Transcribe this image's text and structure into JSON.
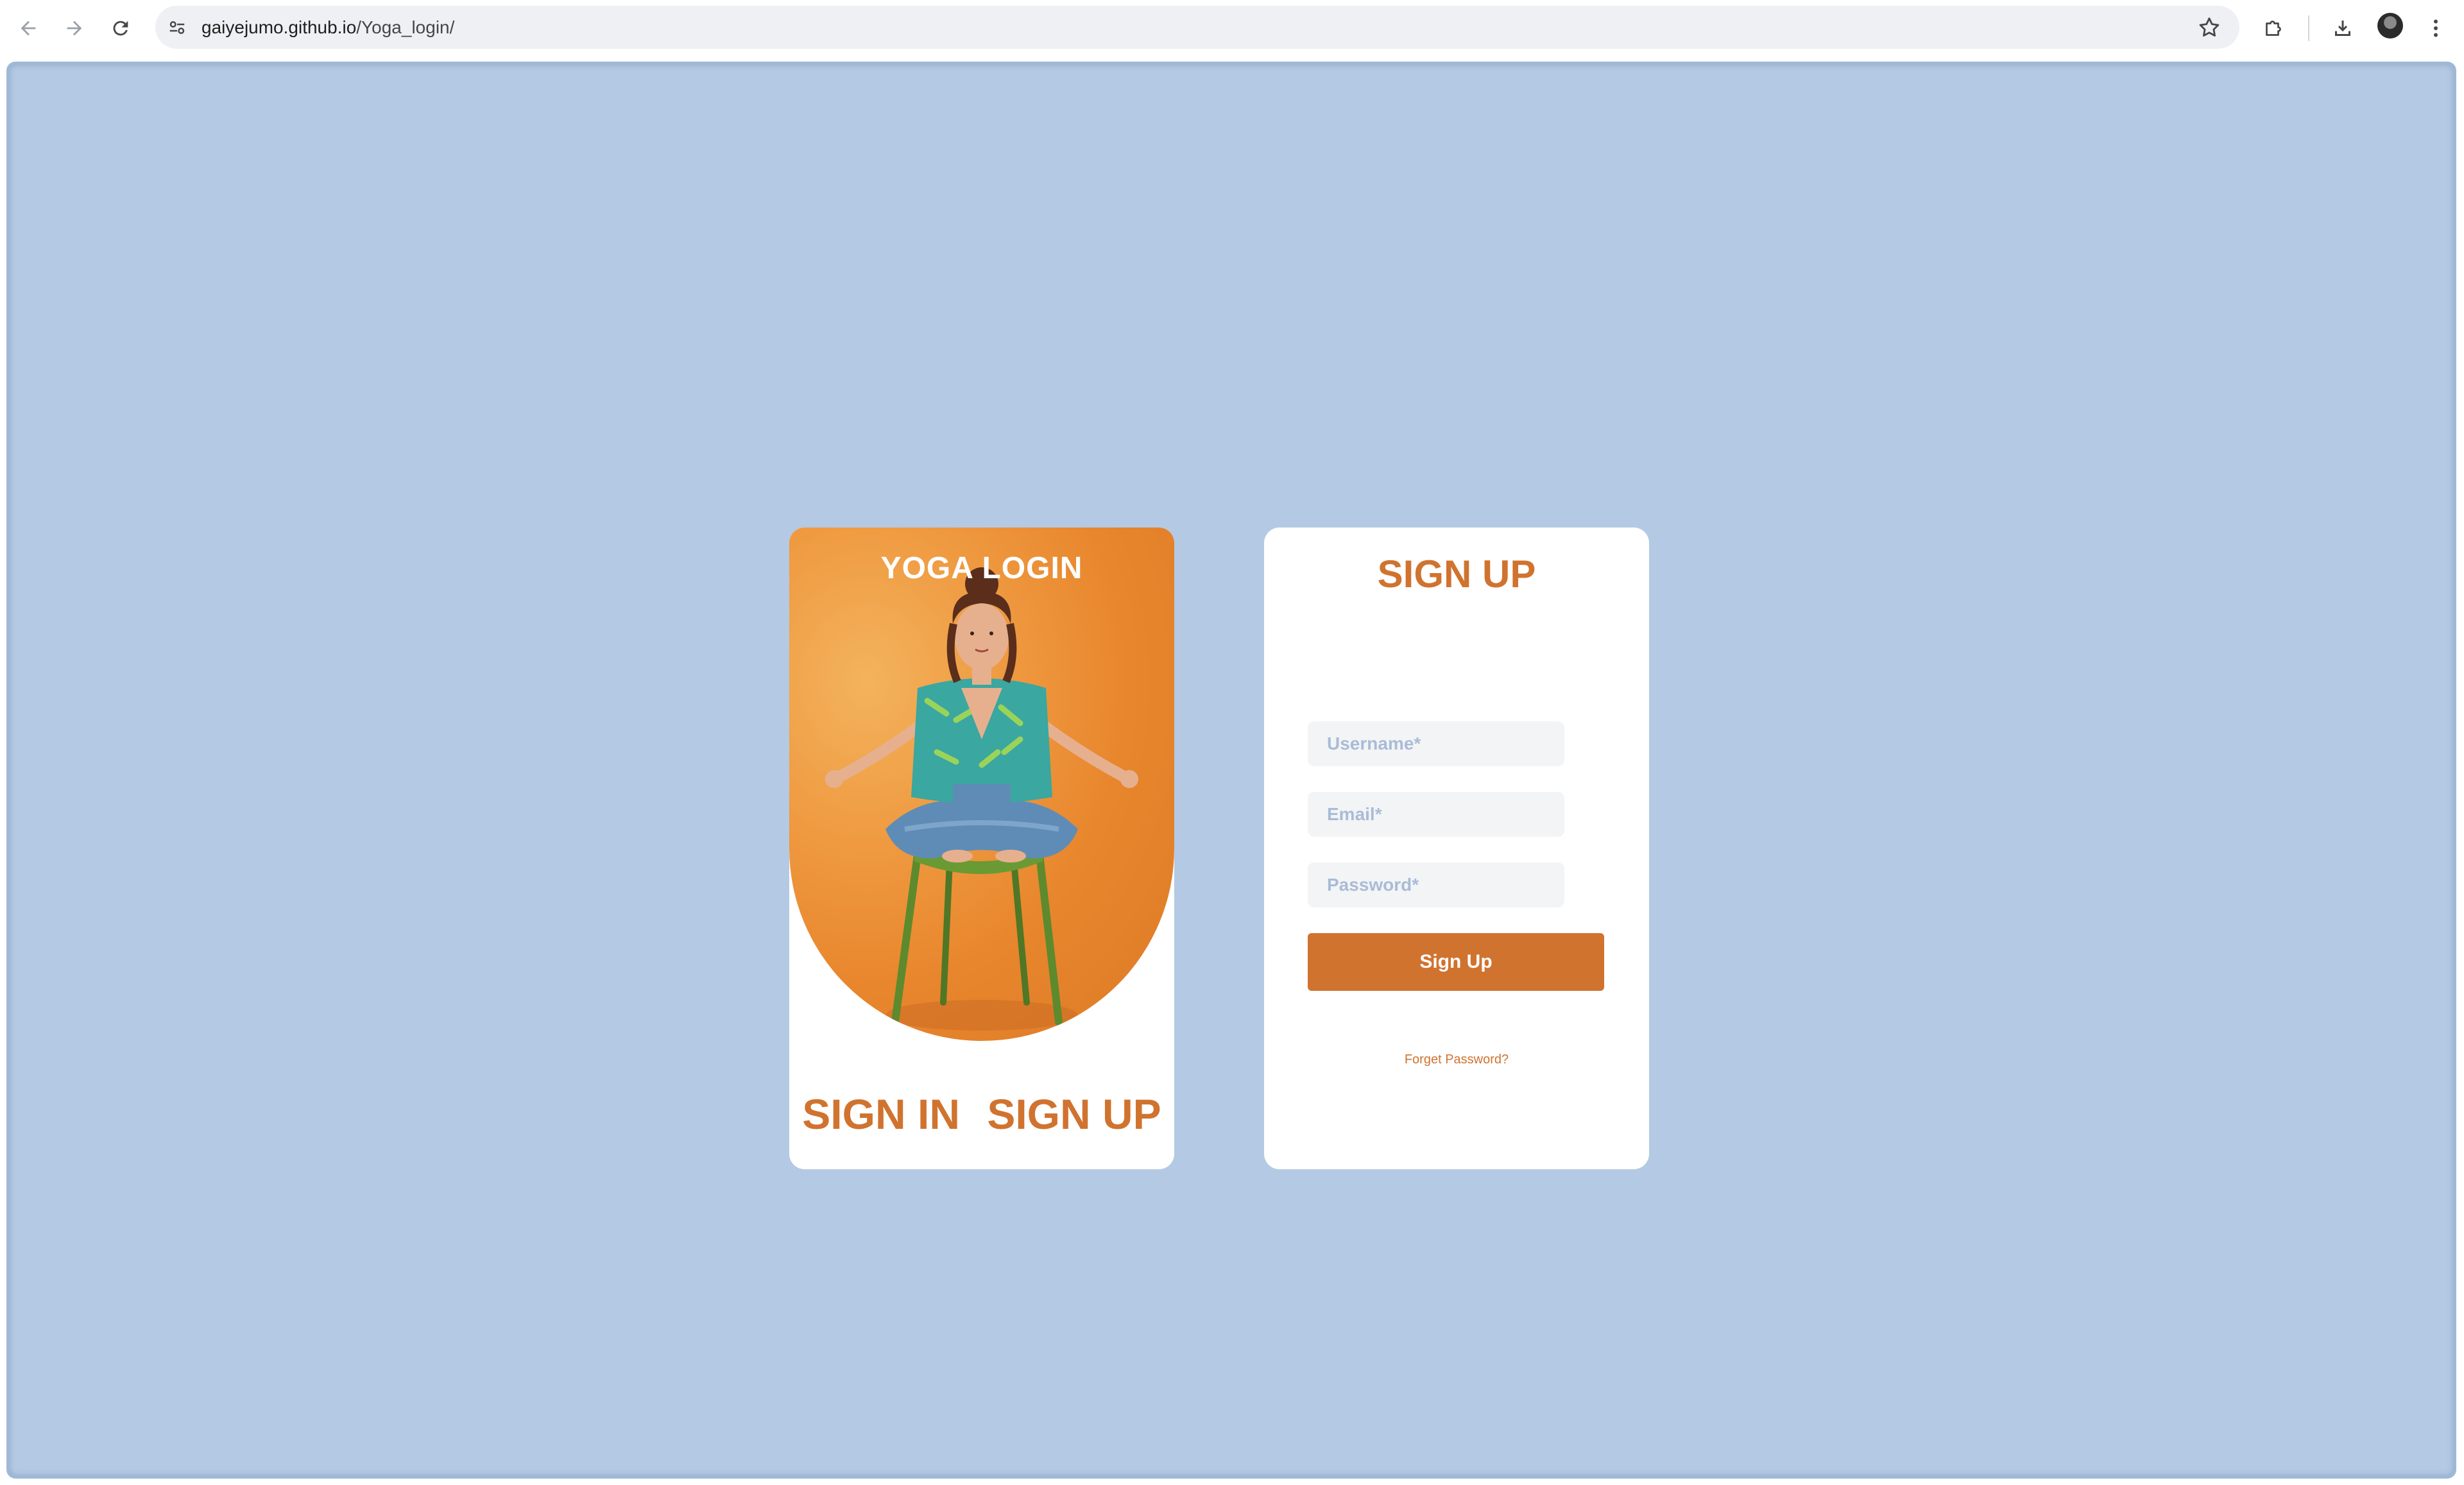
{
  "browser": {
    "url_domain": "gaiyejumo.github.io",
    "url_path": "/Yoga_login/",
    "icons": {
      "back": "arrow-left-icon",
      "forward": "arrow-right-icon",
      "reload": "reload-icon",
      "site_info": "tune-icon",
      "bookmark": "star-icon",
      "extensions": "puzzle-icon",
      "downloads": "download-icon",
      "profile": "avatar-icon",
      "menu": "kebab-menu-icon"
    }
  },
  "page": {
    "background_color": "#b4c9e3",
    "accent_color": "#d0732f",
    "left_card": {
      "title": "YOGA LOGIN",
      "sign_in_label": "SIGN IN",
      "sign_up_label": "SIGN UP"
    },
    "right_card": {
      "title": "SIGN UP",
      "fields": {
        "username_placeholder": "Username*",
        "email_placeholder": "Email*",
        "password_placeholder": "Password*"
      },
      "submit_label": "Sign Up",
      "forgot_label": "Forget Password?"
    }
  }
}
